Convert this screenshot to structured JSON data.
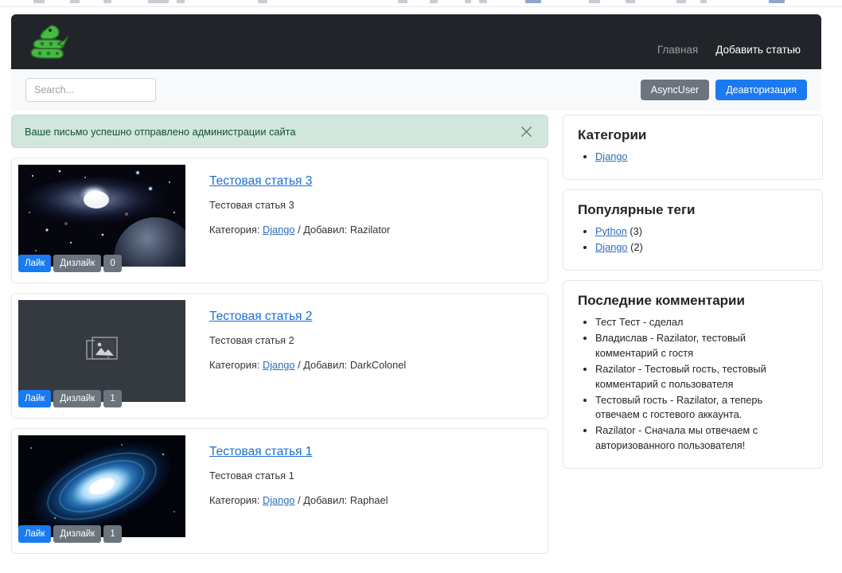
{
  "navbar": {
    "brand_icon": "green-snake-logo",
    "links": [
      {
        "label": "Главная",
        "muted": true
      },
      {
        "label": "Добавить статью",
        "muted": false
      }
    ]
  },
  "subbar": {
    "search_placeholder": "Search...",
    "search_value": "",
    "user_button": "AsyncUser",
    "logout_button": "Деавторизация"
  },
  "alert": {
    "message": "Ваше письмо успешно отправлено администрации сайта",
    "close_icon": "close-icon"
  },
  "articles": [
    {
      "title": "Тестовая статья 3",
      "description": "Тестовая статья 3",
      "meta_prefix": "Категория:",
      "category": "Django",
      "meta_separator": "/ Добавил:",
      "author": "Razilator",
      "like_label": "Лайк",
      "dislike_label": "Дизлайк",
      "count": "0",
      "thumb_type": "galaxy-star-photo"
    },
    {
      "title": "Тестовая статья 2",
      "description": "Тестовая статья 2",
      "meta_prefix": "Категория:",
      "category": "Django",
      "meta_separator": "/ Добавил:",
      "author": "DarkColonel",
      "like_label": "Лайк",
      "dislike_label": "Дизлайк",
      "count": "1",
      "thumb_type": "image-placeholder"
    },
    {
      "title": "Тестовая статья 1",
      "description": "Тестовая статья 1",
      "meta_prefix": "Категория:",
      "category": "Django",
      "meta_separator": "/ Добавил:",
      "author": "Raphael",
      "like_label": "Лайк",
      "dislike_label": "Дизлайк",
      "count": "1",
      "thumb_type": "blue-galaxy-photo"
    }
  ],
  "sidebar": {
    "categories": {
      "title": "Категории",
      "items": [
        {
          "label": "Django"
        }
      ]
    },
    "tags": {
      "title": "Популярные теги",
      "items": [
        {
          "label": "Python",
          "count": "(3)"
        },
        {
          "label": "Django",
          "count": "(2)"
        }
      ]
    },
    "comments": {
      "title": "Последние комментарии",
      "items": [
        {
          "text": "Тест Тест - сделал"
        },
        {
          "text": "Владислав - Razilator, тестовый комментарий с гостя"
        },
        {
          "text": "Razilator - Тестовый гость, тестовый комментарий с пользователя"
        },
        {
          "text": "Тестовый гость - Razilator, а теперь отвечаем с гостевого аккаунта."
        },
        {
          "text": "Razilator - Сначала мы отвечаем с авторизованного пользователя!"
        }
      ]
    }
  },
  "colors": {
    "navbar_bg": "#212529",
    "primary": "#1a7aef",
    "secondary": "#6c757d",
    "alert_bg": "#d1e7dd",
    "link": "#2a6fb8",
    "brand_green": "#4cbb3c"
  }
}
